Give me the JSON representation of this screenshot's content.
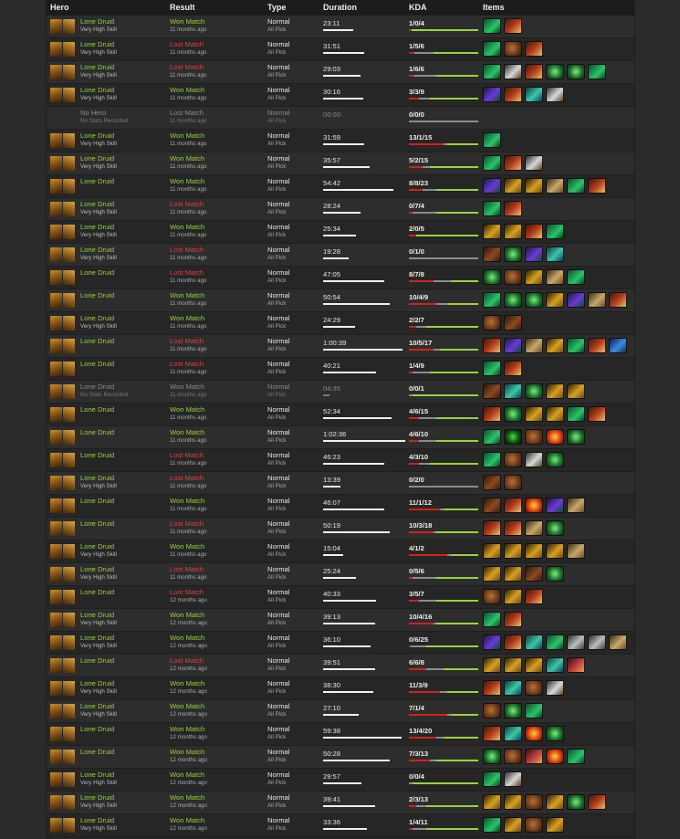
{
  "headers": {
    "hero": "Hero",
    "result": "Result",
    "type": "Type",
    "duration": "Duration",
    "kda": "KDA",
    "items": "Items"
  },
  "colors": {
    "won": "#9bd23c",
    "lost": "#e04040",
    "neutral": "#8a8a8a"
  },
  "rows": [
    {
      "hero": "Lone Druid",
      "skill": "Very High Skill",
      "result": "Won Match",
      "rc": "won",
      "ago": "11 months ago",
      "mode": "Normal",
      "sub": "All Pick",
      "dur": "23:11",
      "dw": 0.23,
      "kda": "1/0/4",
      "k": [
        0.04,
        0.96
      ],
      "items": [
        "boots",
        "roots"
      ]
    },
    {
      "hero": "Lone Druid",
      "skill": "Very High Skill",
      "result": "Lost Match",
      "rc": "lost",
      "ago": "11 months ago",
      "mode": "Normal",
      "sub": "All Pick",
      "dur": "31:51",
      "dw": 0.31,
      "kda": "1/5/6",
      "k": [
        0.08,
        0.65
      ],
      "items": [
        "boots",
        "ball",
        "roots"
      ]
    },
    {
      "hero": "Lone Druid",
      "skill": "Very High Skill",
      "result": "Lost Match",
      "rc": "lost",
      "ago": "11 months ago",
      "mode": "Normal",
      "sub": "All Pick",
      "dur": "29:03",
      "dw": 0.28,
      "kda": "1/6/6",
      "k": [
        0.08,
        0.6
      ],
      "items": [
        "boots",
        "axe",
        "roots",
        "orb",
        "orb",
        "boots"
      ]
    },
    {
      "hero": "Lone Druid",
      "skill": "Very High Skill",
      "result": "Won Match",
      "rc": "won",
      "ago": "11 months ago",
      "mode": "Normal",
      "sub": "All Pick",
      "dur": "30:16",
      "dw": 0.3,
      "kda": "3/3/9",
      "k": [
        0.15,
        0.7
      ],
      "items": [
        "staff",
        "roots",
        "gem",
        "axe"
      ]
    },
    {
      "hero": "No Hero",
      "skill": "No Stats Recorded",
      "result": "Lost Match",
      "rc": "neutral",
      "ago": "11 months ago",
      "mode": "Normal",
      "sub": "All Pick",
      "dur": "00:00",
      "dw": 0,
      "kda": "0/0/0",
      "k": [
        0,
        0
      ],
      "items": [],
      "dim": true,
      "nohero": true
    },
    {
      "hero": "Lone Druid",
      "skill": "Very High Skill",
      "result": "Won Match",
      "rc": "won",
      "ago": "11 months ago",
      "mode": "Normal",
      "sub": "All Pick",
      "dur": "31:59",
      "dw": 0.31,
      "kda": "13/1/15",
      "k": [
        0.5,
        0.45
      ],
      "items": [
        "boots"
      ]
    },
    {
      "hero": "Lone Druid",
      "skill": "Very High Skill",
      "result": "Won Match",
      "rc": "won",
      "ago": "11 months ago",
      "mode": "Normal",
      "sub": "All Pick",
      "dur": "35:57",
      "dw": 0.35,
      "kda": "5/2/15",
      "k": [
        0.2,
        0.7
      ],
      "items": [
        "boots",
        "roots",
        "axe"
      ]
    },
    {
      "hero": "Lone Druid",
      "skill": "",
      "result": "Won Match",
      "rc": "won",
      "ago": "11 months ago",
      "mode": "Normal",
      "sub": "All Pick",
      "dur": "54:42",
      "dw": 0.53,
      "kda": "8/8/23",
      "k": [
        0.2,
        0.6
      ],
      "items": [
        "staff",
        "claw",
        "claw",
        "scroll",
        "boots",
        "roots"
      ]
    },
    {
      "hero": "Lone Druid",
      "skill": "Very High Skill",
      "result": "Lost Match",
      "rc": "lost",
      "ago": "11 months ago",
      "mode": "Normal",
      "sub": "All Pick",
      "dur": "28:24",
      "dw": 0.28,
      "kda": "0/7/4",
      "k": [
        0.05,
        0.6
      ],
      "items": [
        "boots",
        "roots"
      ]
    },
    {
      "hero": "Lone Druid",
      "skill": "Very High Skill",
      "result": "Won Match",
      "rc": "won",
      "ago": "11 months ago",
      "mode": "Normal",
      "sub": "All Pick",
      "dur": "25:34",
      "dw": 0.25,
      "kda": "2/0/5",
      "k": [
        0.1,
        0.9
      ],
      "items": [
        "claw",
        "claw",
        "roots",
        "boots"
      ]
    },
    {
      "hero": "Lone Druid",
      "skill": "Very High Skill",
      "result": "Lost Match",
      "rc": "lost",
      "ago": "11 months ago",
      "mode": "Normal",
      "sub": "All Pick",
      "dur": "19:28",
      "dw": 0.19,
      "kda": "0/1/0",
      "k": [
        0.0,
        0.0
      ],
      "items": [
        "boot2",
        "orb",
        "staff",
        "gem"
      ]
    },
    {
      "hero": "Lone Druid",
      "skill": "",
      "result": "Lost Match",
      "rc": "lost",
      "ago": "11 months ago",
      "mode": "Normal",
      "sub": "All Pick",
      "dur": "47:05",
      "dw": 0.46,
      "kda": "8/7/8",
      "k": [
        0.35,
        0.4
      ],
      "items": [
        "orb",
        "ball",
        "claw",
        "scroll",
        "boots"
      ]
    },
    {
      "hero": "Lone Druid",
      "skill": "",
      "result": "Won Match",
      "rc": "won",
      "ago": "11 months ago",
      "mode": "Normal",
      "sub": "All Pick",
      "dur": "50:54",
      "dw": 0.5,
      "kda": "10/4/9",
      "k": [
        0.4,
        0.45
      ],
      "items": [
        "boots",
        "orb",
        "orb",
        "claw",
        "staff",
        "scroll",
        "roots"
      ]
    },
    {
      "hero": "Lone Druid",
      "skill": "Very High Skill",
      "result": "Won Match",
      "rc": "won",
      "ago": "11 months ago",
      "mode": "Normal",
      "sub": "All Pick",
      "dur": "24:29",
      "dw": 0.24,
      "kda": "2/2/7",
      "k": [
        0.1,
        0.75
      ],
      "items": [
        "ball",
        "boot2"
      ]
    },
    {
      "hero": "Lone Druid",
      "skill": "",
      "result": "Lost Match",
      "rc": "lost",
      "ago": "11 months ago",
      "mode": "Normal",
      "sub": "All Pick",
      "dur": "1:00:39",
      "dw": 0.6,
      "kda": "10/5/17",
      "k": [
        0.35,
        0.55
      ],
      "items": [
        "roots",
        "staff",
        "scroll",
        "claw",
        "boots",
        "roots",
        "blue"
      ]
    },
    {
      "hero": "Lone Druid",
      "skill": "",
      "result": "Lost Match",
      "rc": "lost",
      "ago": "11 months ago",
      "mode": "Normal",
      "sub": "All Pick",
      "dur": "40:21",
      "dw": 0.4,
      "kda": "1/4/9",
      "k": [
        0.05,
        0.7
      ],
      "items": [
        "boots",
        "roots"
      ]
    },
    {
      "hero": "Lone Druid",
      "skill": "No Stats Recorded",
      "result": "Won Match",
      "rc": "neutral",
      "ago": "11 months ago",
      "mode": "Normal",
      "sub": "All Pick",
      "dur": "04:35",
      "dw": 0.05,
      "kda": "0/0/1",
      "k": [
        0,
        0.95
      ],
      "items": [
        "boot2",
        "gem",
        "orb",
        "claw",
        "claw"
      ],
      "dim": true
    },
    {
      "hero": "Lone Druid",
      "skill": "",
      "result": "Won Match",
      "rc": "won",
      "ago": "11 months ago",
      "mode": "Normal",
      "sub": "All Pick",
      "dur": "52:34",
      "dw": 0.52,
      "kda": "4/6/15",
      "k": [
        0.15,
        0.6
      ],
      "items": [
        "roots",
        "orb",
        "claw",
        "claw",
        "boots",
        "roots"
      ]
    },
    {
      "hero": "Lone Druid",
      "skill": "",
      "result": "Won Match",
      "rc": "won",
      "ago": "11 months ago",
      "mode": "Normal",
      "sub": "All Pick",
      "dur": "1:02:36",
      "dw": 0.62,
      "kda": "4/6/10",
      "k": [
        0.15,
        0.6
      ],
      "items": [
        "boots",
        "ring",
        "ball",
        "fire",
        "orb"
      ]
    },
    {
      "hero": "Lone Druid",
      "skill": "",
      "result": "Lost Match",
      "rc": "lost",
      "ago": "11 months ago",
      "mode": "Normal",
      "sub": "All Pick",
      "dur": "46:23",
      "dw": 0.46,
      "kda": "4/3/10",
      "k": [
        0.15,
        0.7
      ],
      "items": [
        "boots",
        "ball",
        "axe",
        "orb"
      ]
    },
    {
      "hero": "Lone Druid",
      "skill": "Very High Skill",
      "result": "Lost Match",
      "rc": "lost",
      "ago": "11 months ago",
      "mode": "Normal",
      "sub": "All Pick",
      "dur": "13:39",
      "dw": 0.13,
      "kda": "0/2/0",
      "k": [
        0,
        0
      ],
      "items": [
        "boot2",
        "ball"
      ]
    },
    {
      "hero": "Lone Druid",
      "skill": "",
      "result": "Won Match",
      "rc": "won",
      "ago": "11 months ago",
      "mode": "Normal",
      "sub": "All Pick",
      "dur": "46:07",
      "dw": 0.46,
      "kda": "11/1/12",
      "k": [
        0.45,
        0.5
      ],
      "items": [
        "boot2",
        "roots",
        "fire",
        "staff",
        "scroll"
      ]
    },
    {
      "hero": "Lone Druid",
      "skill": "",
      "result": "Lost Match",
      "rc": "lost",
      "ago": "11 months ago",
      "mode": "Normal",
      "sub": "All Pick",
      "dur": "50:19",
      "dw": 0.5,
      "kda": "10/3/18",
      "k": [
        0.35,
        0.6
      ],
      "items": [
        "roots",
        "roots",
        "scroll",
        "orb"
      ]
    },
    {
      "hero": "Lone Druid",
      "skill": "Very High Skill",
      "result": "Won Match",
      "rc": "won",
      "ago": "11 months ago",
      "mode": "Normal",
      "sub": "All Pick",
      "dur": "15:04",
      "dw": 0.15,
      "kda": "4/1/2",
      "k": [
        0.55,
        0.4
      ],
      "items": [
        "claw",
        "claw",
        "claw",
        "claw",
        "scroll"
      ]
    },
    {
      "hero": "Lone Druid",
      "skill": "Very High Skill",
      "result": "Lost Match",
      "rc": "lost",
      "ago": "11 months ago",
      "mode": "Normal",
      "sub": "All Pick",
      "dur": "25:24",
      "dw": 0.25,
      "kda": "0/5/6",
      "k": [
        0.05,
        0.6
      ],
      "items": [
        "claw",
        "claw",
        "boot2",
        "orb"
      ]
    },
    {
      "hero": "Lone Druid",
      "skill": "",
      "result": "Lost Match",
      "rc": "lost",
      "ago": "12 months ago",
      "mode": "Normal",
      "sub": "All Pick",
      "dur": "40:33",
      "dw": 0.4,
      "kda": "3/5/7",
      "k": [
        0.15,
        0.6
      ],
      "items": [
        "ball",
        "claw",
        "roots"
      ]
    },
    {
      "hero": "Lone Druid",
      "skill": "Very High Skill",
      "result": "Won Match",
      "rc": "won",
      "ago": "12 months ago",
      "mode": "Normal",
      "sub": "All Pick",
      "dur": "39:13",
      "dw": 0.39,
      "kda": "10/4/16",
      "k": [
        0.35,
        0.6
      ],
      "items": [
        "boots",
        "roots"
      ]
    },
    {
      "hero": "Lone Druid",
      "skill": "Very High Skill",
      "result": "Won Match",
      "rc": "won",
      "ago": "12 months ago",
      "mode": "Normal",
      "sub": "All Pick",
      "dur": "36:10",
      "dw": 0.36,
      "kda": "0/6/25",
      "k": [
        0.02,
        0.75
      ],
      "items": [
        "staff",
        "roots",
        "gem",
        "boots",
        "mask",
        "mask",
        "scroll"
      ]
    },
    {
      "hero": "Lone Druid",
      "skill": "",
      "result": "Lost Match",
      "rc": "lost",
      "ago": "12 months ago",
      "mode": "Normal",
      "sub": "All Pick",
      "dur": "39:51",
      "dw": 0.39,
      "kda": "6/6/8",
      "k": [
        0.25,
        0.5
      ],
      "items": [
        "claw",
        "claw",
        "claw",
        "gem",
        "flame"
      ]
    },
    {
      "hero": "Lone Druid",
      "skill": "Very High Skill",
      "result": "Won Match",
      "rc": "won",
      "ago": "12 months ago",
      "mode": "Normal",
      "sub": "All Pick",
      "dur": "38:30",
      "dw": 0.38,
      "kda": "11/3/9",
      "k": [
        0.45,
        0.45
      ],
      "items": [
        "roots",
        "gem",
        "ball",
        "axe"
      ]
    },
    {
      "hero": "Lone Druid",
      "skill": "Very High Skill",
      "result": "Won Match",
      "rc": "won",
      "ago": "12 months ago",
      "mode": "Normal",
      "sub": "All Pick",
      "dur": "27:10",
      "dw": 0.27,
      "kda": "7/1/4",
      "k": [
        0.55,
        0.4
      ],
      "items": [
        "ball",
        "orb",
        "boots"
      ]
    },
    {
      "hero": "Lone Druid",
      "skill": "",
      "result": "Won Match",
      "rc": "won",
      "ago": "12 months ago",
      "mode": "Normal",
      "sub": "All Pick",
      "dur": "59:38",
      "dw": 0.59,
      "kda": "13/4/20",
      "k": [
        0.4,
        0.5
      ],
      "items": [
        "roots",
        "gem",
        "fire",
        "orb"
      ]
    },
    {
      "hero": "Lone Druid",
      "skill": "",
      "result": "Won Match",
      "rc": "won",
      "ago": "12 months ago",
      "mode": "Normal",
      "sub": "All Pick",
      "dur": "50:28",
      "dw": 0.5,
      "kda": "7/3/13",
      "k": [
        0.3,
        0.6
      ],
      "items": [
        "orb",
        "ball",
        "flame",
        "fire",
        "boots"
      ]
    },
    {
      "hero": "Lone Druid",
      "skill": "Very High Skill",
      "result": "Won Match",
      "rc": "won",
      "ago": "12 months ago",
      "mode": "Normal",
      "sub": "All Pick",
      "dur": "29:57",
      "dw": 0.29,
      "kda": "0/0/4",
      "k": [
        0,
        0.95
      ],
      "items": [
        "boots",
        "axe"
      ]
    },
    {
      "hero": "Lone Druid",
      "skill": "Very High Skill",
      "result": "Won Match",
      "rc": "won",
      "ago": "12 months ago",
      "mode": "Normal",
      "sub": "All Pick",
      "dur": "39:41",
      "dw": 0.39,
      "kda": "2/3/13",
      "k": [
        0.1,
        0.75
      ],
      "items": [
        "claw",
        "claw",
        "ball",
        "claw",
        "orb",
        "roots"
      ]
    },
    {
      "hero": "Lone Druid",
      "skill": "Very High Skill",
      "result": "Won Match",
      "rc": "won",
      "ago": "12 months ago",
      "mode": "Normal",
      "sub": "All Pick",
      "dur": "33:36",
      "dw": 0.33,
      "kda": "1/4/11",
      "k": [
        0.05,
        0.75
      ],
      "items": [
        "boots",
        "claw",
        "ball",
        "claw"
      ]
    }
  ]
}
